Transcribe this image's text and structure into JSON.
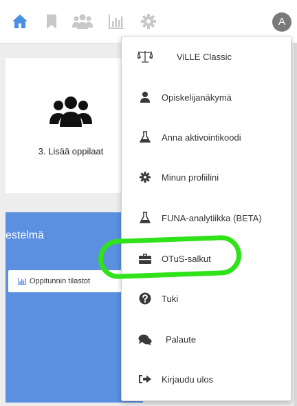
{
  "header": {
    "avatar_initial": "A",
    "icons": [
      "home-icon",
      "bookmark-icon",
      "users-icon",
      "chart-icon",
      "gear-icon"
    ]
  },
  "card": {
    "label": "3. Lisää oppilaat",
    "icon": "users-icon"
  },
  "panel": {
    "title": "estelmä",
    "stats_button_label": "Oppitunnin tilastot"
  },
  "menu": {
    "items": [
      {
        "label": "ViLLE Classic",
        "icon": "scale-icon"
      },
      {
        "label": "Opiskelijanäkymä",
        "icon": "user-icon"
      },
      {
        "label": "Anna aktivointikoodi",
        "icon": "flask-icon"
      },
      {
        "label": "Minun profiilini",
        "icon": "gear-icon"
      },
      {
        "label": "FUNA-analytiikka (BETA)",
        "icon": "flask-icon"
      },
      {
        "label": "OTuS-salkut",
        "icon": "briefcase-icon"
      },
      {
        "label": "Tuki",
        "icon": "question-icon"
      },
      {
        "label": "Palaute",
        "icon": "comments-icon"
      },
      {
        "label": "Kirjaudu ulos",
        "icon": "sign-out-icon"
      }
    ]
  },
  "colors": {
    "accent_blue": "#4a90e2",
    "panel_blue": "#5b8fe0",
    "highlight_green": "#2fe21a",
    "icon_gray": "#c8c8c8",
    "menu_icon_dark": "#3a3a3a"
  }
}
